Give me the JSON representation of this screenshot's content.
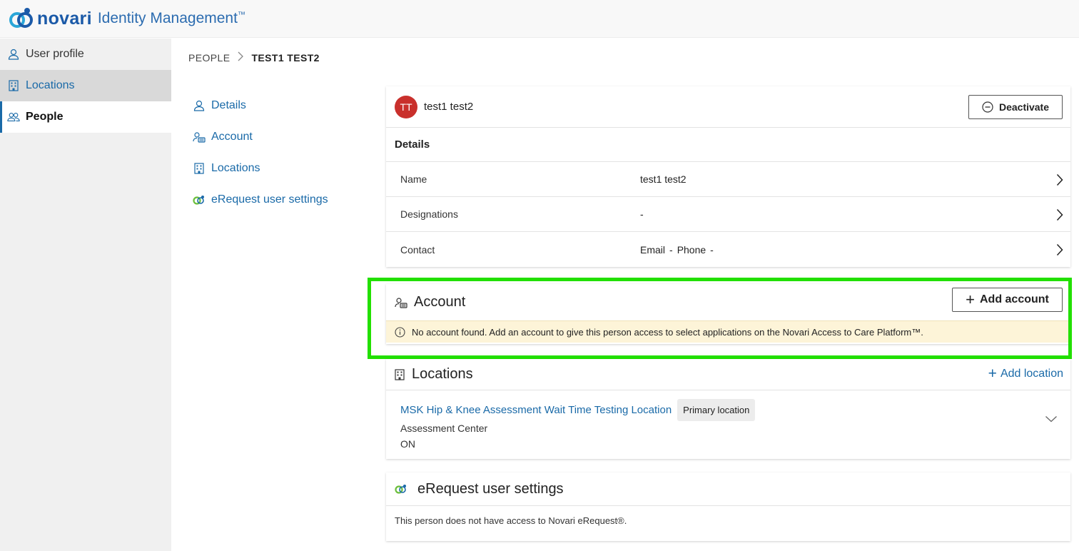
{
  "header": {
    "logo_text": "novari",
    "product_name": "Identity Management",
    "trademark": "™"
  },
  "sidebar": {
    "items": [
      {
        "label": "User profile",
        "icon": "user-icon"
      },
      {
        "label": "Locations",
        "icon": "building-icon"
      },
      {
        "label": "People",
        "icon": "people-icon"
      }
    ]
  },
  "breadcrumb": {
    "parent": "PEOPLE",
    "current": "TEST1 TEST2"
  },
  "section_nav": {
    "items": [
      {
        "label": "Details",
        "icon": "user-icon"
      },
      {
        "label": "Account",
        "icon": "account-icon"
      },
      {
        "label": "Locations",
        "icon": "building-icon"
      },
      {
        "label": "eRequest user settings",
        "icon": "erequest-icon"
      }
    ]
  },
  "person": {
    "initials": "TT",
    "name": "test1  test2",
    "deactivate_label": "Deactivate",
    "details_title": "Details",
    "rows": {
      "name_label": "Name",
      "name_value": "test1  test2",
      "designations_label": "Designations",
      "designations_value": "-",
      "contact_label": "Contact",
      "email_label": "Email",
      "email_value": "-",
      "phone_label": "Phone",
      "phone_value": "-"
    }
  },
  "account": {
    "title": "Account",
    "add_label": "Add account",
    "notice": "No account found. Add an account to give this person access to select applications on the Novari Access to Care Platform™."
  },
  "locations": {
    "title": "Locations",
    "add_label": "Add location",
    "items": [
      {
        "name": "MSK Hip & Knee Assessment Wait Time Testing Location",
        "badge": "Primary location",
        "type": "Assessment Center",
        "province": "ON"
      }
    ]
  },
  "erequest": {
    "title": "eRequest user settings",
    "message": "This person does not have access to Novari eRequest®."
  },
  "colors": {
    "accent": "#1a6aa8",
    "avatar": "#c9302c",
    "highlight": "#22e000",
    "notice_bg": "#fdf4d8"
  }
}
